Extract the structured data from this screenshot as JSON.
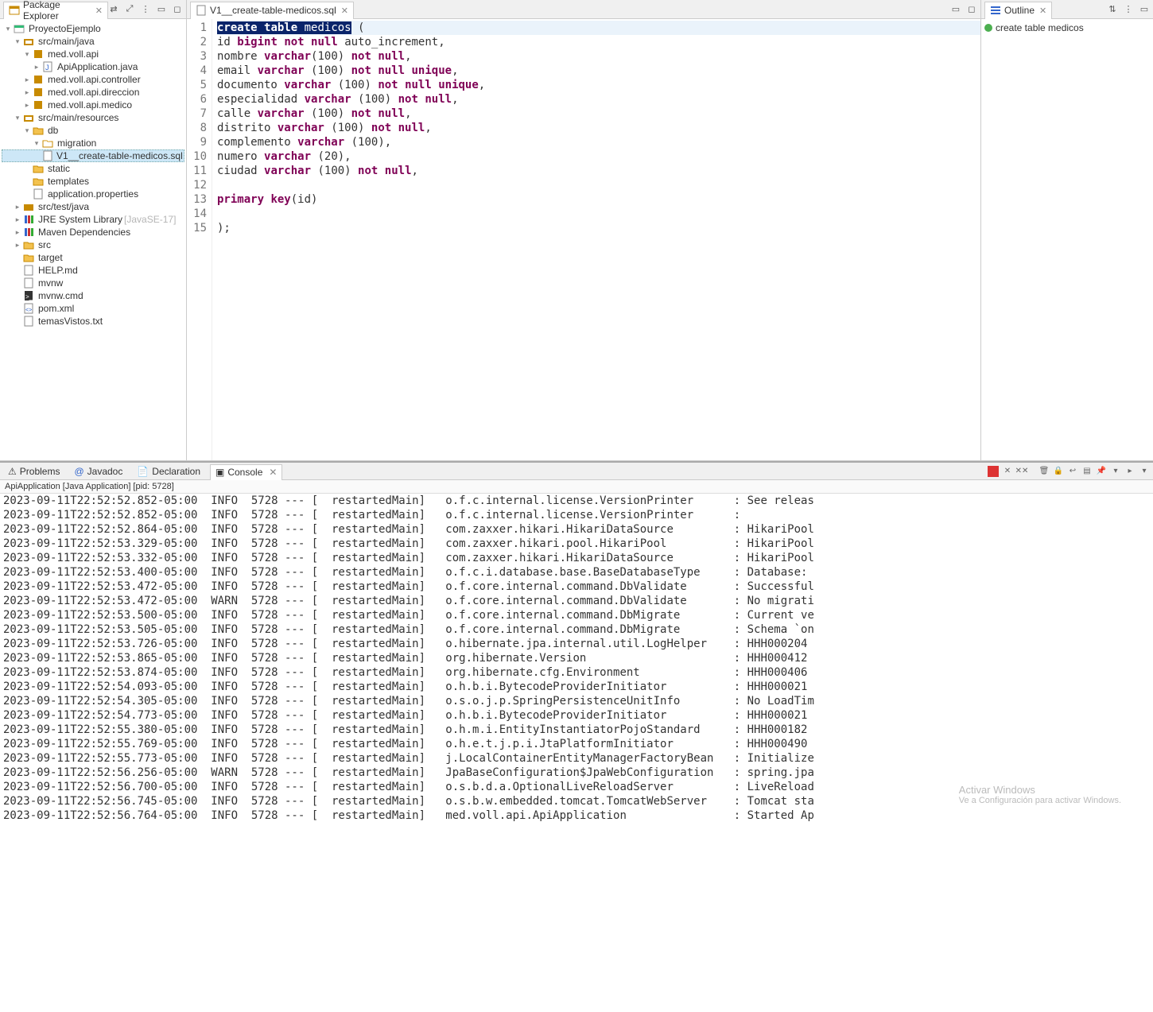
{
  "package_explorer": {
    "title": "Package Explorer",
    "tree": {
      "project": "ProyectoEjemplo",
      "src_main_java": "src/main/java",
      "pkg_api": "med.voll.api",
      "api_app": "ApiApplication.java",
      "pkg_controller": "med.voll.api.controller",
      "pkg_direccion": "med.voll.api.direccion",
      "pkg_medico": "med.voll.api.medico",
      "src_main_res": "src/main/resources",
      "db": "db",
      "migration": "migration",
      "sql_file": "V1__create-table-medicos.sql",
      "static": "static",
      "templates": "templates",
      "app_props": "application.properties",
      "src_test": "src/test/java",
      "jre": "JRE System Library",
      "jre_hint": "[JavaSE-17]",
      "maven": "Maven Dependencies",
      "src_folder": "src",
      "target": "target",
      "help": "HELP.md",
      "mvnw": "mvnw",
      "mvnwcmd": "mvnw.cmd",
      "pom": "pom.xml",
      "temas": "temasVistos.txt"
    }
  },
  "editor": {
    "tab_title": "V1__create-table-medicos.sql",
    "lines": [
      {
        "n": 1,
        "tokens": [
          {
            "t": "create",
            "c": "kw sel"
          },
          {
            "t": " ",
            "c": "sel"
          },
          {
            "t": "table",
            "c": "kw sel"
          },
          {
            "t": " ",
            "c": "sel"
          },
          {
            "t": "medicos",
            "c": "sel"
          },
          {
            "t": " ("
          }
        ],
        "hl": true
      },
      {
        "n": 2,
        "tokens": [
          {
            "t": "id "
          },
          {
            "t": "bigint",
            "c": "kw"
          },
          {
            "t": " "
          },
          {
            "t": "not",
            "c": "kw"
          },
          {
            "t": " "
          },
          {
            "t": "null",
            "c": "kw"
          },
          {
            "t": " auto_increment,"
          }
        ]
      },
      {
        "n": 3,
        "tokens": [
          {
            "t": "nombre "
          },
          {
            "t": "varchar",
            "c": "kw"
          },
          {
            "t": "(100) "
          },
          {
            "t": "not",
            "c": "kw"
          },
          {
            "t": " "
          },
          {
            "t": "null",
            "c": "kw"
          },
          {
            "t": ","
          }
        ]
      },
      {
        "n": 4,
        "tokens": [
          {
            "t": "email "
          },
          {
            "t": "varchar",
            "c": "kw"
          },
          {
            "t": " (100) "
          },
          {
            "t": "not",
            "c": "kw"
          },
          {
            "t": " "
          },
          {
            "t": "null",
            "c": "kw"
          },
          {
            "t": " "
          },
          {
            "t": "unique",
            "c": "kw"
          },
          {
            "t": ","
          }
        ]
      },
      {
        "n": 5,
        "tokens": [
          {
            "t": "documento "
          },
          {
            "t": "varchar",
            "c": "kw"
          },
          {
            "t": " (100) "
          },
          {
            "t": "not",
            "c": "kw"
          },
          {
            "t": " "
          },
          {
            "t": "null",
            "c": "kw"
          },
          {
            "t": " "
          },
          {
            "t": "unique",
            "c": "kw"
          },
          {
            "t": ","
          }
        ]
      },
      {
        "n": 6,
        "tokens": [
          {
            "t": "especialidad "
          },
          {
            "t": "varchar",
            "c": "kw"
          },
          {
            "t": " (100) "
          },
          {
            "t": "not",
            "c": "kw"
          },
          {
            "t": " "
          },
          {
            "t": "null",
            "c": "kw"
          },
          {
            "t": ","
          }
        ]
      },
      {
        "n": 7,
        "tokens": [
          {
            "t": "calle "
          },
          {
            "t": "varchar",
            "c": "kw"
          },
          {
            "t": " (100) "
          },
          {
            "t": "not",
            "c": "kw"
          },
          {
            "t": " "
          },
          {
            "t": "null",
            "c": "kw"
          },
          {
            "t": ","
          }
        ]
      },
      {
        "n": 8,
        "tokens": [
          {
            "t": "distrito "
          },
          {
            "t": "varchar",
            "c": "kw"
          },
          {
            "t": " (100) "
          },
          {
            "t": "not",
            "c": "kw"
          },
          {
            "t": " "
          },
          {
            "t": "null",
            "c": "kw"
          },
          {
            "t": ","
          }
        ]
      },
      {
        "n": 9,
        "tokens": [
          {
            "t": "complemento "
          },
          {
            "t": "varchar",
            "c": "kw"
          },
          {
            "t": " (100),"
          }
        ]
      },
      {
        "n": 10,
        "tokens": [
          {
            "t": "numero "
          },
          {
            "t": "varchar",
            "c": "kw"
          },
          {
            "t": " (20),"
          }
        ]
      },
      {
        "n": 11,
        "tokens": [
          {
            "t": "ciudad "
          },
          {
            "t": "varchar",
            "c": "kw"
          },
          {
            "t": " (100) "
          },
          {
            "t": "not",
            "c": "kw"
          },
          {
            "t": " "
          },
          {
            "t": "null",
            "c": "kw"
          },
          {
            "t": ","
          }
        ]
      },
      {
        "n": 12,
        "tokens": []
      },
      {
        "n": 13,
        "tokens": [
          {
            "t": "primary",
            "c": "kw"
          },
          {
            "t": " "
          },
          {
            "t": "key",
            "c": "kw"
          },
          {
            "t": "(id)"
          }
        ]
      },
      {
        "n": 14,
        "tokens": []
      },
      {
        "n": 15,
        "tokens": [
          {
            "t": ");"
          }
        ]
      }
    ]
  },
  "outline": {
    "title": "Outline",
    "item": "create table medicos"
  },
  "bottom": {
    "tabs": {
      "problems": "Problems",
      "javadoc": "Javadoc",
      "declaration": "Declaration",
      "console": "Console"
    },
    "launch": "ApiApplication [Java Application]  [pid: 5728]",
    "rows": [
      {
        "ts": "2023-09-11T22:52:52.852-05:00",
        "lvl": "INFO",
        "pid": "5728",
        "th": "restartedMain",
        "cls": "o.f.c.internal.license.VersionPrinter",
        "msg": "See releas"
      },
      {
        "ts": "2023-09-11T22:52:52.852-05:00",
        "lvl": "INFO",
        "pid": "5728",
        "th": "restartedMain",
        "cls": "o.f.c.internal.license.VersionPrinter",
        "msg": ""
      },
      {
        "ts": "2023-09-11T22:52:52.864-05:00",
        "lvl": "INFO",
        "pid": "5728",
        "th": "restartedMain",
        "cls": "com.zaxxer.hikari.HikariDataSource",
        "msg": "HikariPool"
      },
      {
        "ts": "2023-09-11T22:52:53.329-05:00",
        "lvl": "INFO",
        "pid": "5728",
        "th": "restartedMain",
        "cls": "com.zaxxer.hikari.pool.HikariPool",
        "msg": "HikariPool"
      },
      {
        "ts": "2023-09-11T22:52:53.332-05:00",
        "lvl": "INFO",
        "pid": "5728",
        "th": "restartedMain",
        "cls": "com.zaxxer.hikari.HikariDataSource",
        "msg": "HikariPool"
      },
      {
        "ts": "2023-09-11T22:52:53.400-05:00",
        "lvl": "INFO",
        "pid": "5728",
        "th": "restartedMain",
        "cls": "o.f.c.i.database.base.BaseDatabaseType",
        "msg": "Database:"
      },
      {
        "ts": "2023-09-11T22:52:53.472-05:00",
        "lvl": "INFO",
        "pid": "5728",
        "th": "restartedMain",
        "cls": "o.f.core.internal.command.DbValidate",
        "msg": "Successful"
      },
      {
        "ts": "2023-09-11T22:52:53.472-05:00",
        "lvl": "WARN",
        "pid": "5728",
        "th": "restartedMain",
        "cls": "o.f.core.internal.command.DbValidate",
        "msg": "No migrati"
      },
      {
        "ts": "2023-09-11T22:52:53.500-05:00",
        "lvl": "INFO",
        "pid": "5728",
        "th": "restartedMain",
        "cls": "o.f.core.internal.command.DbMigrate",
        "msg": "Current ve"
      },
      {
        "ts": "2023-09-11T22:52:53.505-05:00",
        "lvl": "INFO",
        "pid": "5728",
        "th": "restartedMain",
        "cls": "o.f.core.internal.command.DbMigrate",
        "msg": "Schema `on"
      },
      {
        "ts": "2023-09-11T22:52:53.726-05:00",
        "lvl": "INFO",
        "pid": "5728",
        "th": "restartedMain",
        "cls": "o.hibernate.jpa.internal.util.LogHelper",
        "msg": "HHH000204"
      },
      {
        "ts": "2023-09-11T22:52:53.865-05:00",
        "lvl": "INFO",
        "pid": "5728",
        "th": "restartedMain",
        "cls": "org.hibernate.Version",
        "msg": "HHH000412"
      },
      {
        "ts": "2023-09-11T22:52:53.874-05:00",
        "lvl": "INFO",
        "pid": "5728",
        "th": "restartedMain",
        "cls": "org.hibernate.cfg.Environment",
        "msg": "HHH000406"
      },
      {
        "ts": "2023-09-11T22:52:54.093-05:00",
        "lvl": "INFO",
        "pid": "5728",
        "th": "restartedMain",
        "cls": "o.h.b.i.BytecodeProviderInitiator",
        "msg": "HHH000021"
      },
      {
        "ts": "2023-09-11T22:52:54.305-05:00",
        "lvl": "INFO",
        "pid": "5728",
        "th": "restartedMain",
        "cls": "o.s.o.j.p.SpringPersistenceUnitInfo",
        "msg": "No LoadTim"
      },
      {
        "ts": "2023-09-11T22:52:54.773-05:00",
        "lvl": "INFO",
        "pid": "5728",
        "th": "restartedMain",
        "cls": "o.h.b.i.BytecodeProviderInitiator",
        "msg": "HHH000021"
      },
      {
        "ts": "2023-09-11T22:52:55.380-05:00",
        "lvl": "INFO",
        "pid": "5728",
        "th": "restartedMain",
        "cls": "o.h.m.i.EntityInstantiatorPojoStandard",
        "msg": "HHH000182"
      },
      {
        "ts": "2023-09-11T22:52:55.769-05:00",
        "lvl": "INFO",
        "pid": "5728",
        "th": "restartedMain",
        "cls": "o.h.e.t.j.p.i.JtaPlatformInitiator",
        "msg": "HHH000490"
      },
      {
        "ts": "2023-09-11T22:52:55.773-05:00",
        "lvl": "INFO",
        "pid": "5728",
        "th": "restartedMain",
        "cls": "j.LocalContainerEntityManagerFactoryBean",
        "msg": "Initialize"
      },
      {
        "ts": "2023-09-11T22:52:56.256-05:00",
        "lvl": "WARN",
        "pid": "5728",
        "th": "restartedMain",
        "cls": "JpaBaseConfiguration$JpaWebConfiguration",
        "msg": "spring.jpa"
      },
      {
        "ts": "2023-09-11T22:52:56.700-05:00",
        "lvl": "INFO",
        "pid": "5728",
        "th": "restartedMain",
        "cls": "o.s.b.d.a.OptionalLiveReloadServer",
        "msg": "LiveReload"
      },
      {
        "ts": "2023-09-11T22:52:56.745-05:00",
        "lvl": "INFO",
        "pid": "5728",
        "th": "restartedMain",
        "cls": "o.s.b.w.embedded.tomcat.TomcatWebServer",
        "msg": "Tomcat sta"
      },
      {
        "ts": "2023-09-11T22:52:56.764-05:00",
        "lvl": "INFO",
        "pid": "5728",
        "th": "restartedMain",
        "cls": "med.voll.api.ApiApplication",
        "msg": "Started Ap"
      }
    ]
  },
  "watermark": {
    "t1": "Activar Windows",
    "t2": "Ve a Configuración para activar Windows."
  }
}
